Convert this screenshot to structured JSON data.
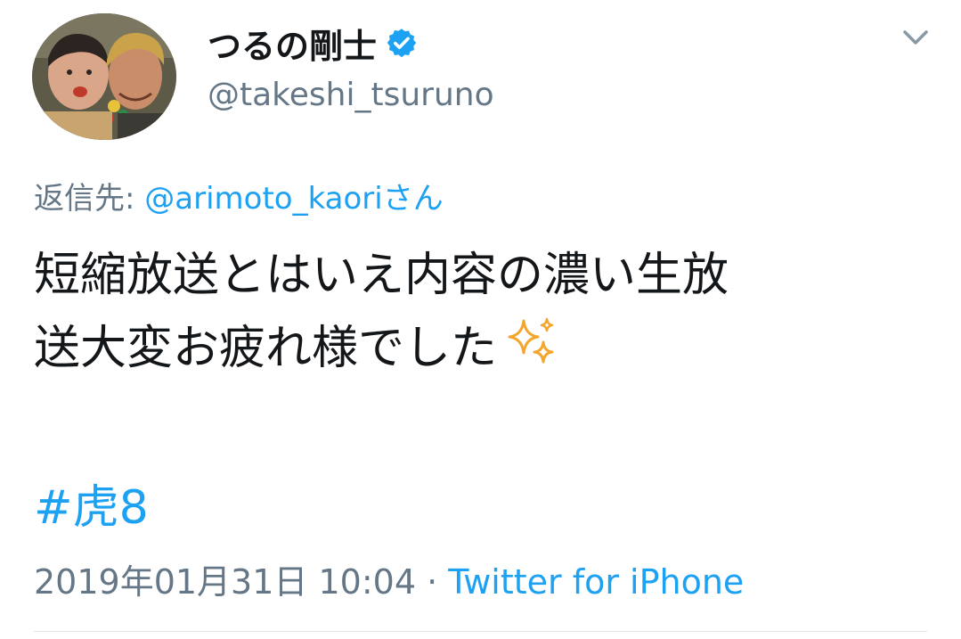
{
  "tweet": {
    "author": {
      "display_name": "つるの剛士",
      "handle": "@takeshi_tsuruno",
      "verified": true
    },
    "reply": {
      "prefix": "返信先: ",
      "mention": "@arimoto_kaoriさん"
    },
    "text_line1": "短縮放送とはいえ内容の濃い生放",
    "text_line2": "送大変お疲れ様でした",
    "hashtag": "#虎8",
    "timestamp": "2019年01月31日 10:04",
    "separator": " · ",
    "source": "Twitter for iPhone"
  },
  "icons": {
    "verified": "verified-badge-icon",
    "menu": "chevron-down-icon",
    "emoji": "sparkles-emoji"
  },
  "colors": {
    "link": "#1da1f2",
    "secondary": "#657786",
    "text": "#14171a",
    "sparkle": "#f4a52b"
  }
}
